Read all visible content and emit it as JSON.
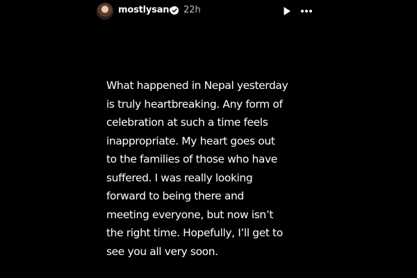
{
  "header": {
    "username": "mostlysane",
    "time": "22h",
    "verified_icon": "verified-badge-icon",
    "play_icon": "play-icon",
    "more_icon": "more-options-icon"
  },
  "story": {
    "text": "What happened in Nepal yesterday\nis truly heartbreaking. Any form of\ncelebration at such a time feels\ninappropriate. My heart goes out\nto the families of those who have\nsuffered. I was really looking\nforward to being there and\nmeeting everyone, but now isn’t\nthe right time. Hopefully, I’ll get to\nsee you all very soon."
  },
  "colors": {
    "background": "#000000",
    "text": "#ffffff",
    "muted": "#bdbdbd"
  }
}
